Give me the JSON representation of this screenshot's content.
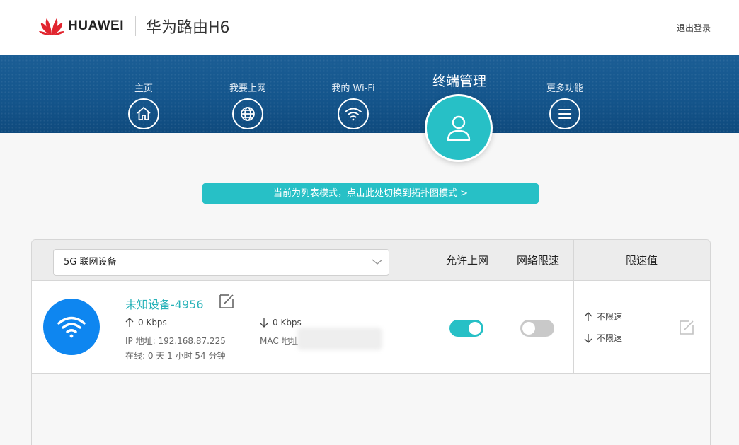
{
  "header": {
    "brand": "HUAWEI",
    "product": "华为路由H6",
    "logout": "退出登录"
  },
  "nav": {
    "items": [
      {
        "label": "主页",
        "icon": "home-icon"
      },
      {
        "label": "我要上网",
        "icon": "globe-icon"
      },
      {
        "label": "我的 Wi-Fi",
        "icon": "wifi-icon"
      },
      {
        "label": "终端管理",
        "icon": "user-icon",
        "active": true
      },
      {
        "label": "更多功能",
        "icon": "menu-icon"
      }
    ]
  },
  "mode_switch": "当前为列表模式，点击此处切换到拓扑图模式 >",
  "table": {
    "filter_selected": "5G 联网设备",
    "columns": [
      "允许上网",
      "网络限速",
      "限速值"
    ],
    "rows": [
      {
        "name": "未知设备-4956",
        "upload": "0 Kbps",
        "download": "0 Kbps",
        "ip": "IP 地址: 192.168.87.225",
        "mac": "MAC 地址",
        "online": "在线: 0 天 1 小时 54 分钟",
        "allow_internet": true,
        "speed_limit": false,
        "limit_up": "不限速",
        "limit_down": "不限速"
      }
    ]
  },
  "colors": {
    "accent": "#27c0c6",
    "banner": "#14558c",
    "device_avatar": "#0e86f0"
  }
}
